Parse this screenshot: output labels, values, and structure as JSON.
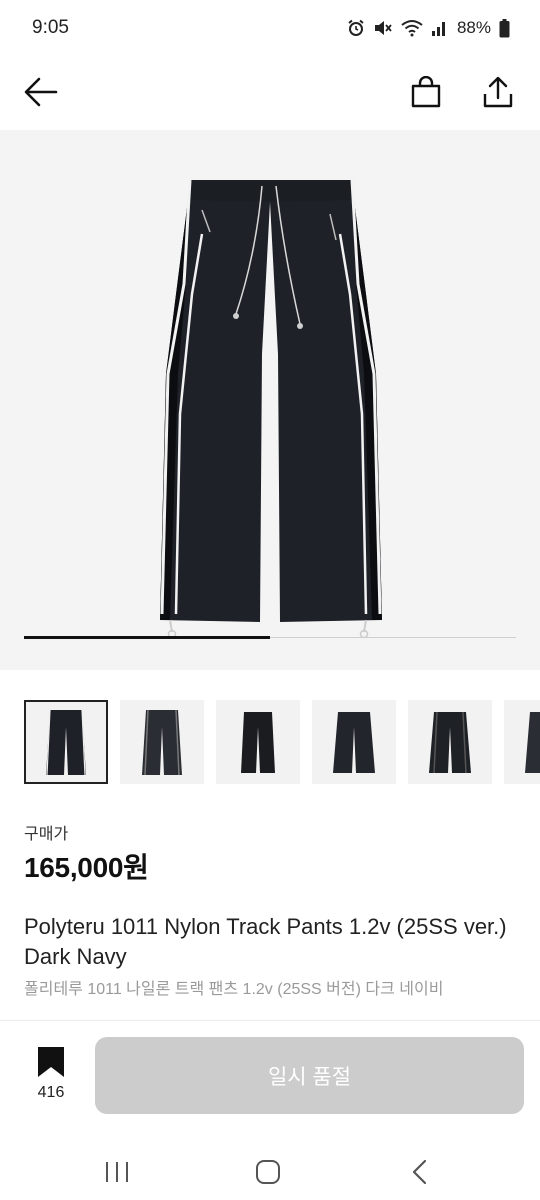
{
  "status_bar": {
    "time": "9:05",
    "battery": "88%",
    "icons": [
      "alarm-icon",
      "mute-icon",
      "wifi-icon",
      "signal-icon",
      "battery-icon"
    ]
  },
  "header": {
    "icons": [
      "back-arrow-icon",
      "shopping-bag-icon",
      "share-icon"
    ]
  },
  "gallery": {
    "progress": 0.5,
    "thumbnail_count": 6,
    "selected_index": 0
  },
  "product": {
    "price_label": "구매가",
    "price": "165,000원",
    "name_en": "Polyteru 1011 Nylon Track Pants 1.2v (25SS ver.) Dark Navy",
    "name_ko": "폴리테루 1011 나일론 트랙 팬츠 1.2v (25SS 버전) 다크 네이비"
  },
  "actions": {
    "bookmark_count": "416",
    "status_button_label": "일시 품절"
  },
  "nav_bar": {
    "icons": [
      "recent-apps-icon",
      "home-icon",
      "back-icon"
    ]
  },
  "colors": {
    "disabled_button": "#cccccc",
    "hero_background": "#f4f4f4",
    "pants": "#1b1f24"
  }
}
